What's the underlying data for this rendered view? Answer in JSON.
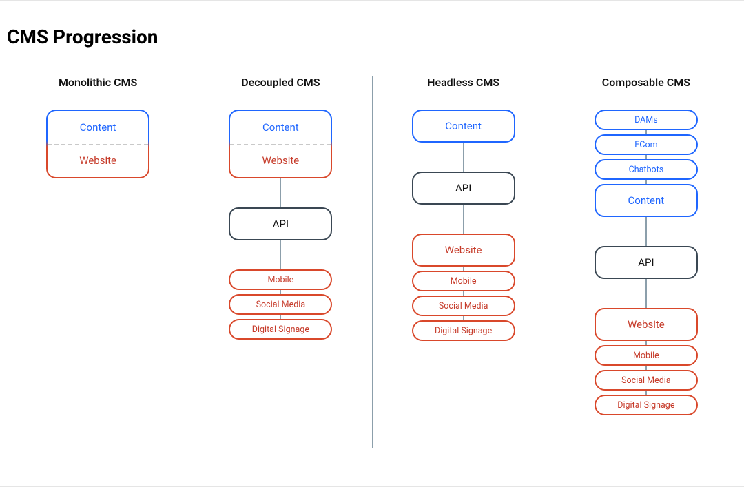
{
  "title": "CMS Progression",
  "columns": [
    {
      "label": "Monolithic CMS"
    },
    {
      "label": "Decoupled CMS"
    },
    {
      "label": "Headless CMS"
    },
    {
      "label": "Composable CMS"
    }
  ],
  "labels": {
    "content": "Content",
    "website": "Website",
    "api": "API",
    "mobile": "Mobile",
    "social": "Social Media",
    "signage": "Digital Signage",
    "dams": "DAMs",
    "ecom": "ECom",
    "chatbots": "Chatbots"
  }
}
